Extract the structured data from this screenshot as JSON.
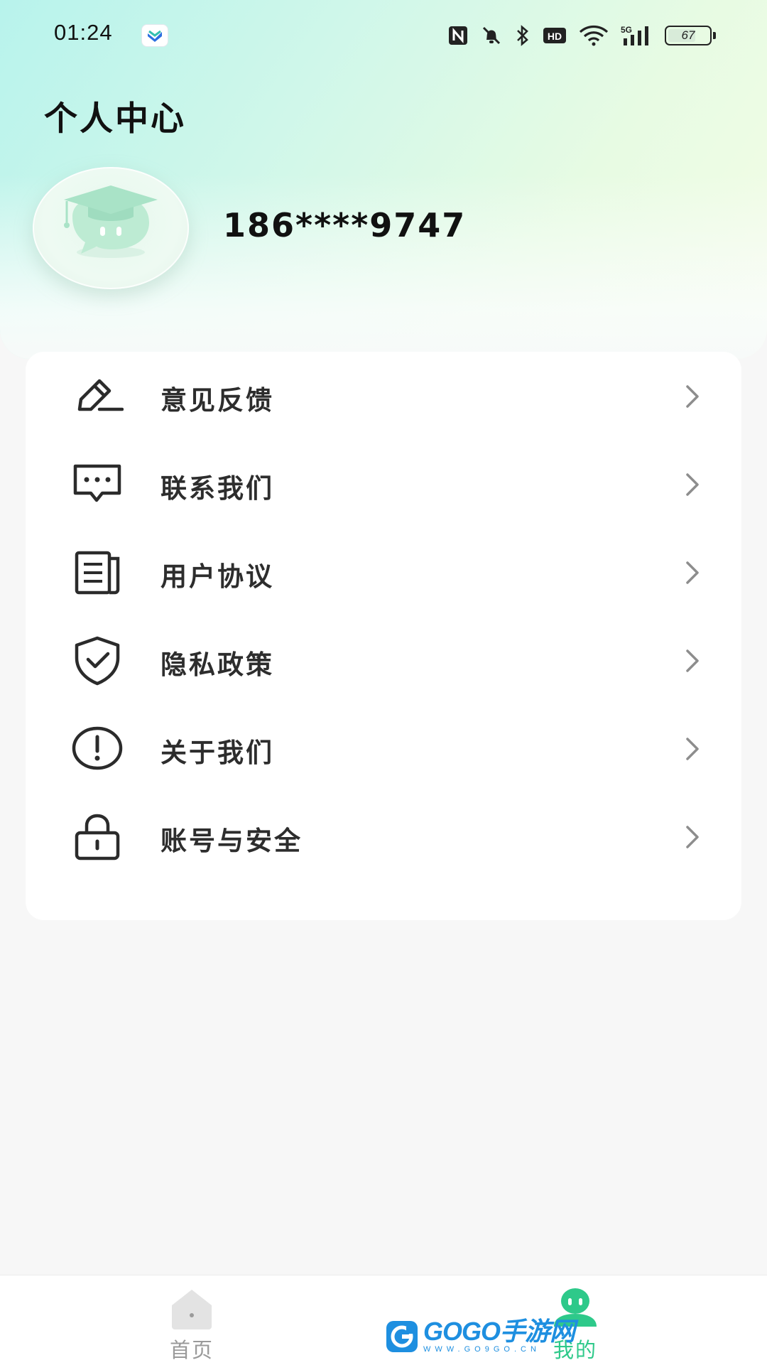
{
  "status_bar": {
    "time": "01:24",
    "battery": "67",
    "icons": [
      "nfc-icon",
      "bell-muted-icon",
      "bluetooth-icon",
      "hd-icon",
      "wifi-icon",
      "signal-5g-icon",
      "battery-icon"
    ]
  },
  "header": {
    "title": "个人中心",
    "phone": "186****9747",
    "avatar_icon": "graduation-cap-chat-bubble-icon"
  },
  "menu": {
    "items": [
      {
        "label": "意见反馈",
        "icon": "pencil-icon"
      },
      {
        "label": "联系我们",
        "icon": "chat-bubble-icon"
      },
      {
        "label": "用户协议",
        "icon": "document-icon"
      },
      {
        "label": "隐私政策",
        "icon": "shield-check-icon"
      },
      {
        "label": "关于我们",
        "icon": "info-exclamation-icon"
      },
      {
        "label": "账号与安全",
        "icon": "lock-icon"
      }
    ]
  },
  "tabbar": {
    "home_label": "首页",
    "mine_label": "我的",
    "active": "mine",
    "active_color": "#2ec98a",
    "inactive_color": "#9a9a9a"
  },
  "watermark": {
    "main": "GOGO手游网",
    "sub": "WWW.GO9GO.CN"
  }
}
